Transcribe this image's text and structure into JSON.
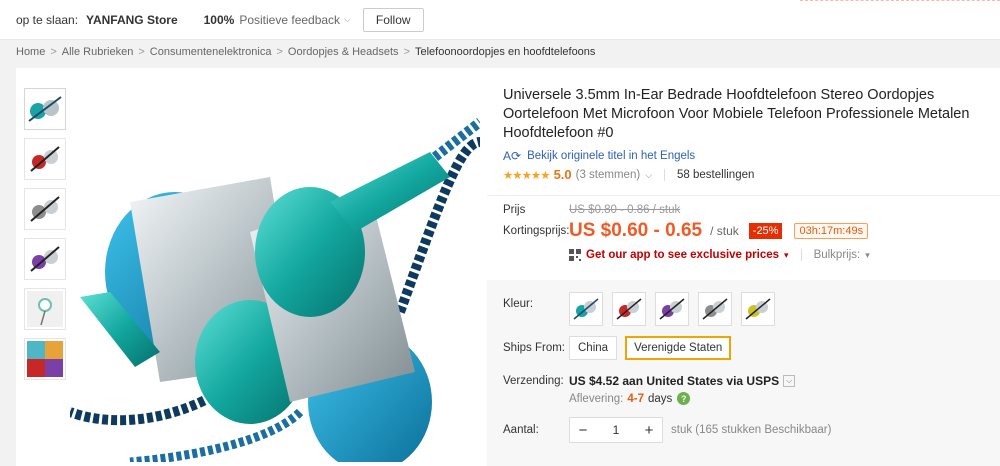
{
  "storebar": {
    "goto_label": "op te slaan:",
    "store_name": "YANFANG Store",
    "feedback_pct": "100%",
    "feedback_label": "Positieve feedback",
    "follow_label": "Follow"
  },
  "breadcrumb": [
    "Home",
    "Alle Rubrieken",
    "Consumentenelektronica",
    "Oordopjes & Headsets",
    "Telefoonoordopjes en hoofdtelefoons"
  ],
  "product": {
    "title": "Universele 3.5mm In-Ear Bedrade Hoofdtelefoon Stereo Oordopjes Oortelefoon Met Microfoon Voor Mobiele Telefoon Professionele Metalen Hoofdtelefoon #0",
    "original_title_link": "Bekijk originele titel in het Engels",
    "stars": "★★★★★",
    "score": "5.0",
    "votes": "(3 stemmen)",
    "orders": "58 bestellingen"
  },
  "price": {
    "label_price": "Prijs",
    "old_price": "US $0.80 - 0.86 / stuk",
    "label_discount": "Kortingsprijs:",
    "new_price": "US $0.60 - 0.65",
    "unit": "/ stuk",
    "discount": "-25%",
    "timer": "03h:17m:49s",
    "app_text": "Get our app to see exclusive prices",
    "bulk_label": "Bulkprijs:"
  },
  "options": {
    "color_label": "Kleur:",
    "swatch_colors": [
      "#1aa3a3",
      "#c62828",
      "#7b3fa8",
      "#9e9e9e",
      "#c9c22b"
    ],
    "ships_label": "Ships From:",
    "ships": [
      "China",
      "Verenigde Staten"
    ],
    "ships_selected": 1,
    "shipping_label": "Verzending:",
    "shipping_fee": "US $4.52 aan United States via USPS",
    "delivery_label": "Aflevering:",
    "delivery_days": "4-7",
    "delivery_unit": "days",
    "qty_label": "Aantal:",
    "qty_value": "1",
    "stock": "stuk (165 stukken Beschikbaar)"
  },
  "thumb_colors": [
    "#1aa3a3",
    "#c62828",
    "#9e9e9e",
    "#7b3fa8",
    "#6fbfb2",
    "#e8a23a"
  ],
  "colors": {
    "accent": "#f15a24",
    "link": "#2d5fb8",
    "discount_bg": "#e62e04",
    "selected_border": "#f0a500"
  }
}
